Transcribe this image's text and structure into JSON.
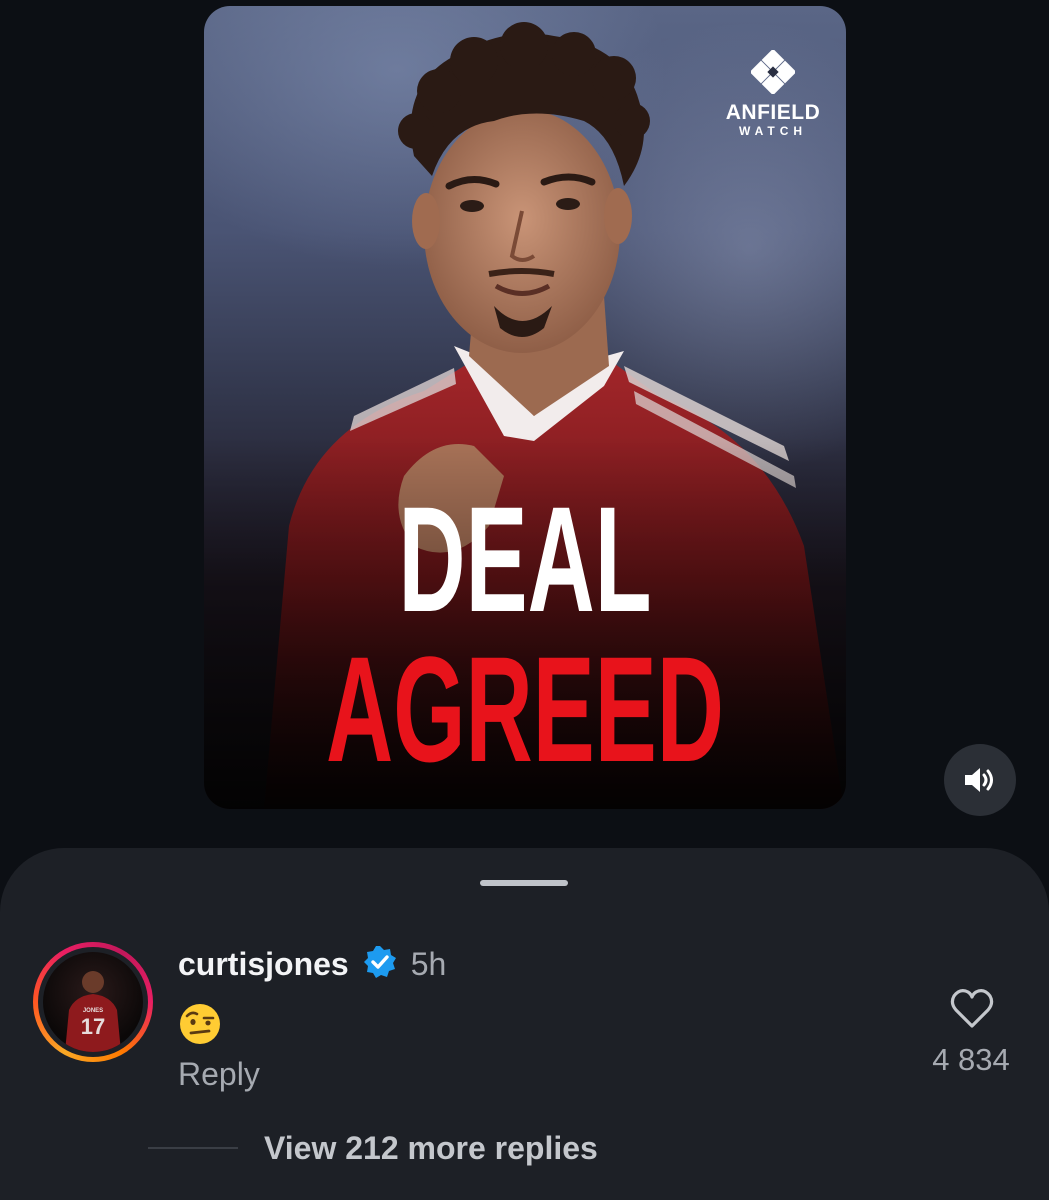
{
  "post": {
    "brand_name": "ANFIELD",
    "brand_sub": "WATCH",
    "headline_line1": "DEAL",
    "headline_line2": "AGREED",
    "headline_colors": {
      "line1": "#ffffff",
      "line2": "#e8131b"
    }
  },
  "controls": {
    "volume_icon": "speaker-volume-icon"
  },
  "comment": {
    "username": "curtisjones",
    "verified_icon": "verified-badge-icon",
    "time_ago": "5h",
    "emoji": "face-with-raised-eyebrow",
    "reply_label": "Reply",
    "like_icon": "heart-outline-icon",
    "like_count": "4 834",
    "view_replies_label": "View 212 more replies"
  },
  "colors": {
    "background": "#0c0f14",
    "sheet": "#1d2026",
    "verified_blue": "#1d9bf0",
    "muted_text": "#a6aab1"
  }
}
